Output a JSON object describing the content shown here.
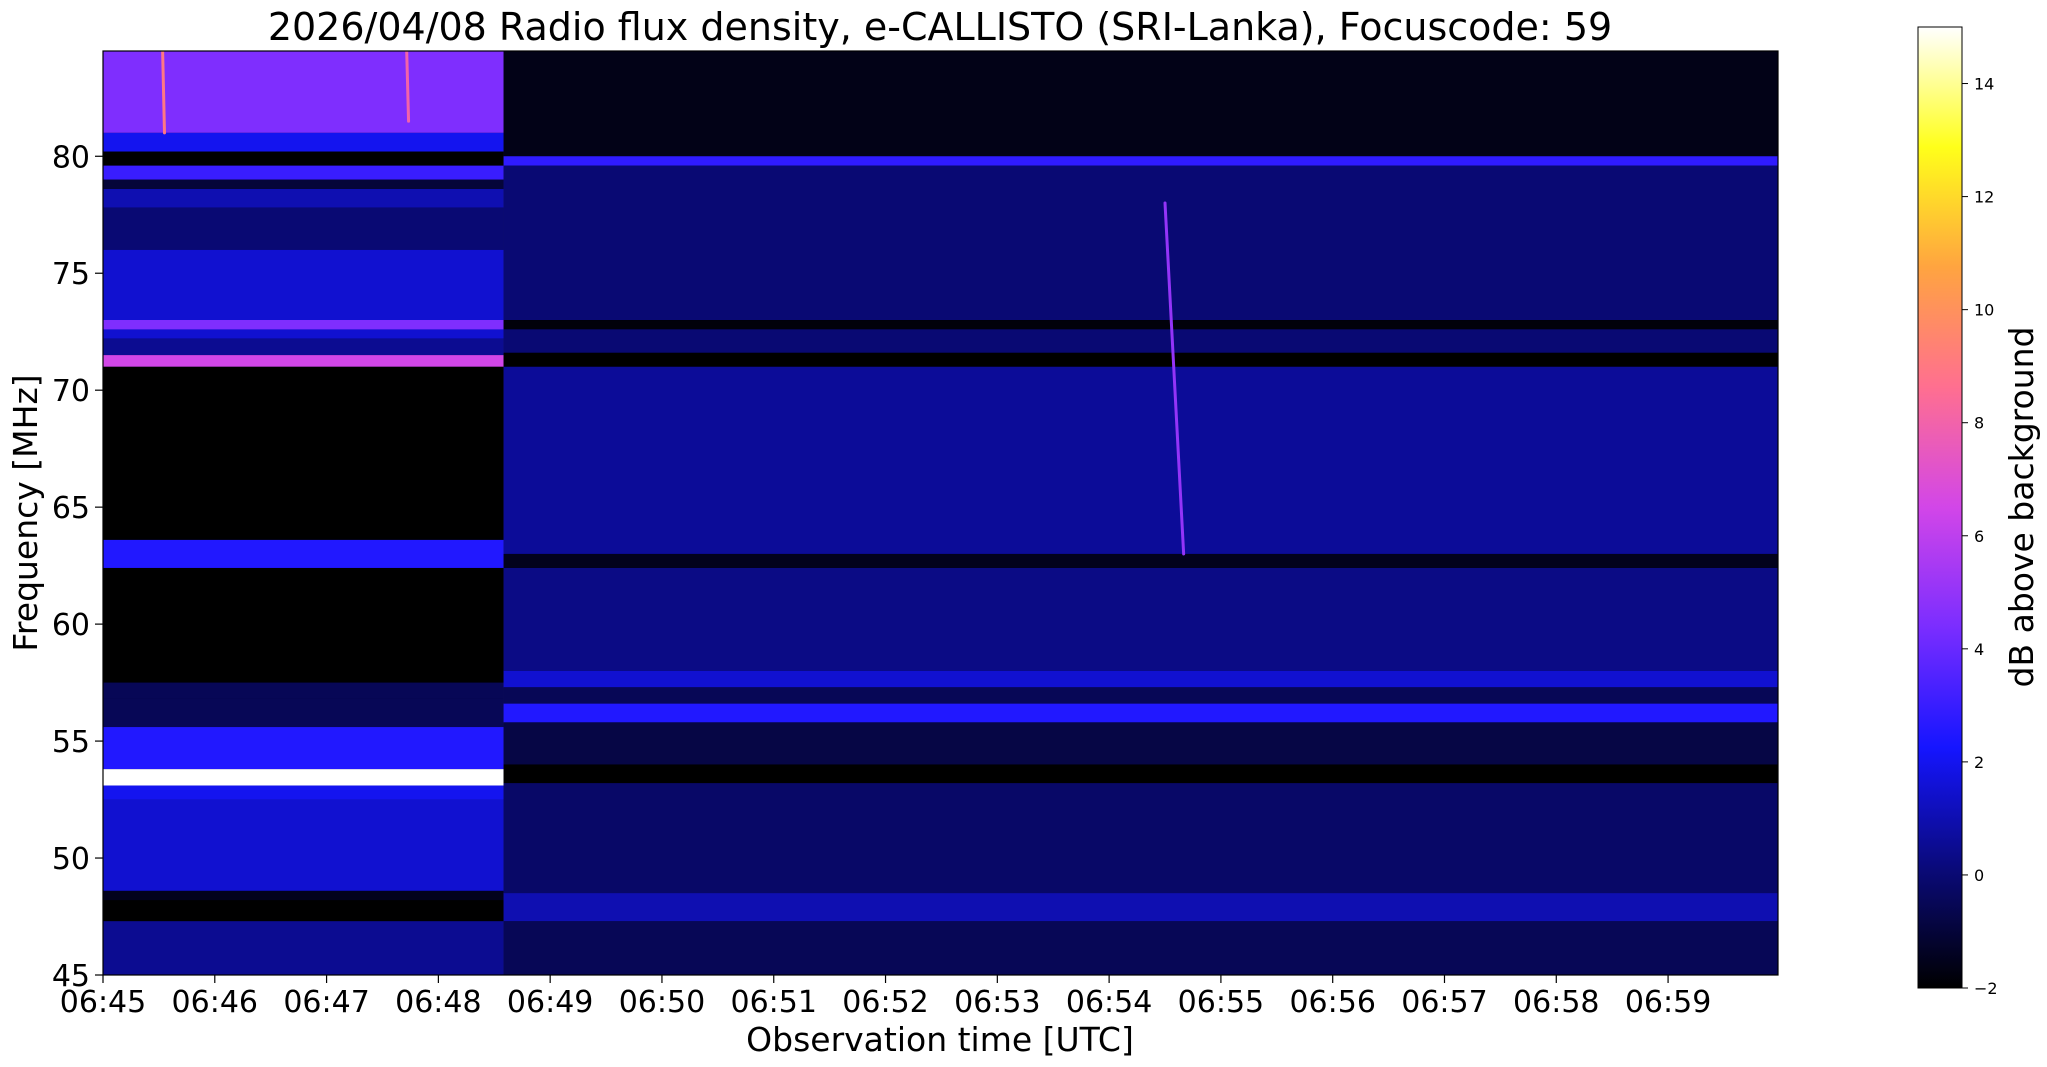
{
  "chart_data": {
    "type": "heatmap",
    "title": "2026/04/08  Radio flux density, e-CALLISTO (SRI-Lanka), Focuscode: 59",
    "xlabel": "Observation time [UTC]",
    "ylabel": "Frequency [MHz]",
    "colorbar_label": "dB above background",
    "x_ticks": [
      "06:45",
      "06:46",
      "06:47",
      "06:48",
      "06:49",
      "06:50",
      "06:51",
      "06:52",
      "06:53",
      "06:54",
      "06:55",
      "06:56",
      "06:57",
      "06:58",
      "06:59"
    ],
    "x_range": [
      "06:45:00",
      "06:59:59"
    ],
    "y_ticks": [
      45,
      50,
      55,
      60,
      65,
      70,
      75,
      80
    ],
    "y_range": [
      45,
      84.5
    ],
    "colorbar_ticks": [
      -2,
      0,
      2,
      4,
      6,
      8,
      10,
      12,
      14
    ],
    "colorbar_range": [
      -2,
      15
    ],
    "colormap": "gnuplot2",
    "colormap_stops": [
      "#000000",
      "#0a0a7a",
      "#1515ff",
      "#7a2dff",
      "#d246e8",
      "#ff6f90",
      "#ffa440",
      "#ffff1a",
      "#ffffff"
    ],
    "segments": [
      {
        "name": "early",
        "t_start": "06:45:00",
        "t_end": "06:48:35",
        "background_db": -1.5,
        "bands": [
          {
            "f_low": 81.0,
            "f_high": 84.5,
            "db": 4.5
          },
          {
            "f_low": 80.2,
            "f_high": 81.0,
            "db": 2.0
          },
          {
            "f_low": 79.6,
            "f_high": 80.2,
            "db": -2.0
          },
          {
            "f_low": 79.0,
            "f_high": 79.6,
            "db": 3.0
          },
          {
            "f_low": 78.6,
            "f_high": 79.0,
            "db": -1.0
          },
          {
            "f_low": 77.8,
            "f_high": 78.6,
            "db": 1.0
          },
          {
            "f_low": 76.0,
            "f_high": 77.8,
            "db": 0.0
          },
          {
            "f_low": 72.2,
            "f_high": 76.0,
            "db": 1.5
          },
          {
            "f_low": 72.6,
            "f_high": 73.0,
            "db": 4.5
          },
          {
            "f_low": 71.5,
            "f_high": 72.2,
            "db": 0.5
          },
          {
            "f_low": 71.0,
            "f_high": 71.5,
            "db": 6.5
          },
          {
            "f_low": 63.6,
            "f_high": 71.0,
            "db": -2.0
          },
          {
            "f_low": 62.4,
            "f_high": 63.6,
            "db": 2.5
          },
          {
            "f_low": 57.5,
            "f_high": 62.4,
            "db": -2.0
          },
          {
            "f_low": 56.8,
            "f_high": 57.5,
            "db": -0.5
          },
          {
            "f_low": 55.6,
            "f_high": 56.8,
            "db": -0.5
          },
          {
            "f_low": 54.6,
            "f_high": 55.6,
            "db": -2.0
          },
          {
            "f_low": 53.8,
            "f_high": 55.6,
            "db": 2.5
          },
          {
            "f_low": 53.1,
            "f_high": 53.8,
            "db": 15.0
          },
          {
            "f_low": 52.5,
            "f_high": 53.1,
            "db": 2.0
          },
          {
            "f_low": 48.6,
            "f_high": 52.5,
            "db": 1.5
          },
          {
            "f_low": 47.3,
            "f_high": 48.2,
            "db": -2.0
          },
          {
            "f_low": 45.0,
            "f_high": 47.3,
            "db": 0.5
          }
        ]
      },
      {
        "name": "late",
        "t_start": "06:48:35",
        "t_end": "06:59:59",
        "background_db": -0.7,
        "bands": [
          {
            "f_low": 80.0,
            "f_high": 84.5,
            "db": -1.6
          },
          {
            "f_low": 79.6,
            "f_high": 80.0,
            "db": 2.8
          },
          {
            "f_low": 73.0,
            "f_high": 79.6,
            "db": 0.0
          },
          {
            "f_low": 72.6,
            "f_high": 73.0,
            "db": -1.8
          },
          {
            "f_low": 71.6,
            "f_high": 72.6,
            "db": 0.0
          },
          {
            "f_low": 71.0,
            "f_high": 71.6,
            "db": -2.0
          },
          {
            "f_low": 63.0,
            "f_high": 71.0,
            "db": 0.6
          },
          {
            "f_low": 62.4,
            "f_high": 63.0,
            "db": -1.5
          },
          {
            "f_low": 58.0,
            "f_high": 62.4,
            "db": 0.3
          },
          {
            "f_low": 57.3,
            "f_high": 58.0,
            "db": 1.5
          },
          {
            "f_low": 56.6,
            "f_high": 57.3,
            "db": -0.5
          },
          {
            "f_low": 55.8,
            "f_high": 56.6,
            "db": 2.5
          },
          {
            "f_low": 54.0,
            "f_high": 55.8,
            "db": -0.8
          },
          {
            "f_low": 53.2,
            "f_high": 54.0,
            "db": -2.0
          },
          {
            "f_low": 48.5,
            "f_high": 53.2,
            "db": -0.2
          },
          {
            "f_low": 47.3,
            "f_high": 48.5,
            "db": 1.0
          },
          {
            "f_low": 45.0,
            "f_high": 47.3,
            "db": -0.5
          }
        ]
      }
    ],
    "features": [
      {
        "name": "drifting burst",
        "t_start": "06:54:30",
        "f_start": 78.0,
        "t_end": "06:54:40",
        "f_end": 63.0,
        "db": 5.0
      },
      {
        "name": "flare streak",
        "t_start": "06:45:32",
        "f_start": 84.5,
        "t_end": "06:45:33",
        "f_end": 81.0,
        "db": 9.0
      },
      {
        "name": "flare streak",
        "t_start": "06:47:43",
        "f_start": 84.5,
        "t_end": "06:47:44",
        "f_end": 81.5,
        "db": 8.0
      }
    ],
    "grid": false
  }
}
